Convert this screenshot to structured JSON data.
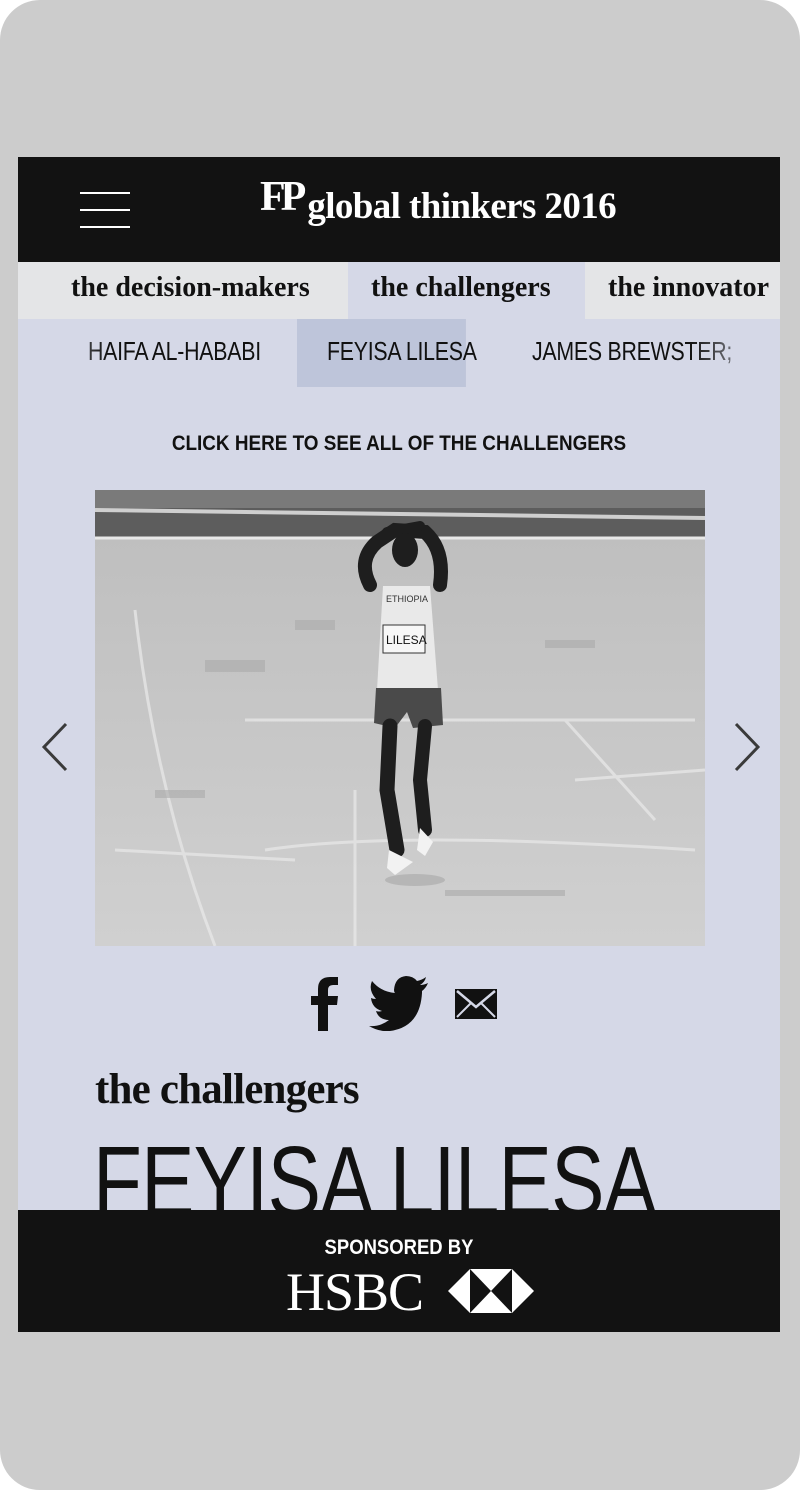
{
  "header": {
    "logo_fp": "FP",
    "logo_text": "global thinkers 2016"
  },
  "category_tabs": [
    {
      "label": "the decision-makers",
      "active": false
    },
    {
      "label": "the challengers",
      "active": true
    },
    {
      "label": "the innovator",
      "active": false
    }
  ],
  "person_tabs": [
    {
      "label": "HAIFA AL-HABABI",
      "active": false
    },
    {
      "label": "FEYISA LILESA",
      "active": true
    },
    {
      "label": "JAMES BREWSTER;",
      "active": false
    }
  ],
  "see_all_link": "CLICK HERE TO SEE ALL OF THE CHALLENGERS",
  "photo": {
    "bib_label": "LILESA",
    "shirt_label": "ETHIOPIA"
  },
  "share_icons": [
    "facebook-icon",
    "twitter-icon",
    "email-icon"
  ],
  "profile": {
    "section": "the challengers",
    "name": "FEYISA LILESA"
  },
  "sponsor": {
    "label": "SPONSORED BY",
    "brand": "HSBC"
  },
  "colors": {
    "background": "#d5d8e7",
    "header": "#121212",
    "active_person_tab": "#bec5da",
    "tab_bar": "#e4e5e7"
  }
}
